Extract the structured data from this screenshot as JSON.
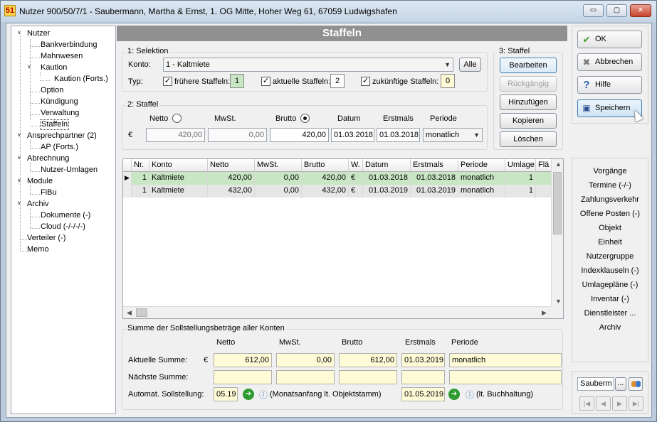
{
  "window": {
    "title": "Nutzer 900/50/7/1 - Saubermann, Martha & Ernst, 1. OG Mitte, Hoher Weg 61, 67059 Ludwigshafen",
    "icon_text": "51",
    "minimize": "▭",
    "maximize": "▢",
    "close": "✕"
  },
  "tree": [
    {
      "label": "Nutzer",
      "toggle": "∨"
    },
    {
      "label": "Bankverbindung"
    },
    {
      "label": "Mahnwesen"
    },
    {
      "label": "Kaution",
      "toggle": "∨"
    },
    {
      "label": "Kaution (Forts.)"
    },
    {
      "label": "Option"
    },
    {
      "label": "Kündigung"
    },
    {
      "label": "Verwaltung"
    },
    {
      "label": "Staffeln"
    },
    {
      "label": "Ansprechpartner (2)",
      "toggle": "∨"
    },
    {
      "label": "AP (Forts.)"
    },
    {
      "label": "Abrechnung",
      "toggle": "∨"
    },
    {
      "label": "Nutzer-Umlagen"
    },
    {
      "label": "Module",
      "toggle": "∨"
    },
    {
      "label": "FiBu"
    },
    {
      "label": "Archiv",
      "toggle": "∨"
    },
    {
      "label": "Dokumente (-)"
    },
    {
      "label": "Cloud (-/-/-/-)"
    },
    {
      "label": "Verteiler (-)"
    },
    {
      "label": "Memo"
    }
  ],
  "header": {
    "title": "Staffeln"
  },
  "selektion": {
    "group_label": "1: Selektion",
    "konto_label": "Konto:",
    "konto_value": "1 - Kaltmiete",
    "alle_button": "Alle",
    "typ_label": "Typ:",
    "fruehere_label": "frühere Staffeln:",
    "fruehere_count": "1",
    "aktuelle_label": "aktuelle Staffeln:",
    "aktuelle_count": "2",
    "zukuenftige_label": "zukünftige Staffeln:",
    "zukuenftige_count": "0",
    "check_mark": "✓"
  },
  "staffel_actions": {
    "group_label": "3: Staffel",
    "bearbeiten": "Bearbeiten",
    "rueckgaengig": "Rückgängig",
    "hinzufuegen": "Hinzufügen",
    "kopieren": "Kopieren",
    "loeschen": "Löschen"
  },
  "staffel": {
    "group_label": "2: Staffel",
    "netto_label": "Netto",
    "mwst_label": "MwSt.",
    "brutto_label": "Brutto",
    "datum_label": "Datum",
    "erstmals_label": "Erstmals",
    "periode_label": "Periode",
    "currency": "€",
    "netto_value": "420,00",
    "mwst_value": "0,00",
    "brutto_value": "420,00",
    "datum_value": "01.03.2018",
    "erstmals_value": "01.03.2018",
    "periode_value": "monatlich"
  },
  "table": {
    "columns": [
      "Nr.",
      "Konto",
      "Netto",
      "MwSt.",
      "Brutto",
      "W.",
      "Datum",
      "Erstmals",
      "Periode",
      "Umlage",
      "Flä"
    ],
    "rows": [
      {
        "indicator": "▶",
        "nr": "1",
        "konto": "Kaltmiete",
        "netto": "420,00",
        "mwst": "0,00",
        "brutto": "420,00",
        "w": "€",
        "datum": "01.03.2018",
        "erstmals": "01.03.2018",
        "periode": "monatlich",
        "umlage": "1"
      },
      {
        "indicator": "",
        "nr": "1",
        "konto": "Kaltmiete",
        "netto": "432,00",
        "mwst": "0,00",
        "brutto": "432,00",
        "w": "€",
        "datum": "01.03.2019",
        "erstmals": "01.03.2019",
        "periode": "monatlich",
        "umlage": "1"
      }
    ]
  },
  "summe": {
    "group_label": "Summe der Sollstellungsbeträge aller Konten",
    "netto_label": "Netto",
    "mwst_label": "MwSt.",
    "brutto_label": "Brutto",
    "erstmals_label": "Erstmals",
    "periode_label": "Periode",
    "aktuelle_label": "Aktuelle Summe:",
    "currency": "€",
    "aktuelle_netto": "612,00",
    "aktuelle_mwst": "0,00",
    "aktuelle_brutto": "612,00",
    "aktuelle_erstmals": "01.03.2019",
    "aktuelle_periode": "monatlich",
    "naechste_label": "Nächste Summe:",
    "automat_label": "Automat. Sollstellung:",
    "automat_value1": "05.19",
    "automat_note1": "(Monatsanfang lt. Objektstamm)",
    "automat_value2": "01.05.2019",
    "automat_note2": "(lt. Buchhaltung)",
    "go_arrow": "➔",
    "info_icon": "ⓘ"
  },
  "actions": {
    "ok": "OK",
    "abbrechen": "Abbrechen",
    "hilfe": "Hilfe",
    "speichern": "Speichern"
  },
  "links": [
    "Vorgänge",
    "Termine (-/-)",
    "Zahlungsverkehr",
    "Offene Posten (-)",
    "Objekt",
    "Einheit",
    "Nutzergruppe",
    "Indexklauseln (-)",
    "Umlagepläne (-)",
    "Inventar (-)",
    "Dienstleister ...",
    "Archiv"
  ],
  "footer": {
    "user_value": "Sauberm",
    "ellipsis": "...",
    "nav_first": "|◀",
    "nav_prev": "◀",
    "nav_next": "▶",
    "nav_last": "▶|"
  },
  "colors": {
    "header_bg": "#909090",
    "selected_row": "#c8e6c3",
    "field_yellow": "#fffbd6"
  }
}
